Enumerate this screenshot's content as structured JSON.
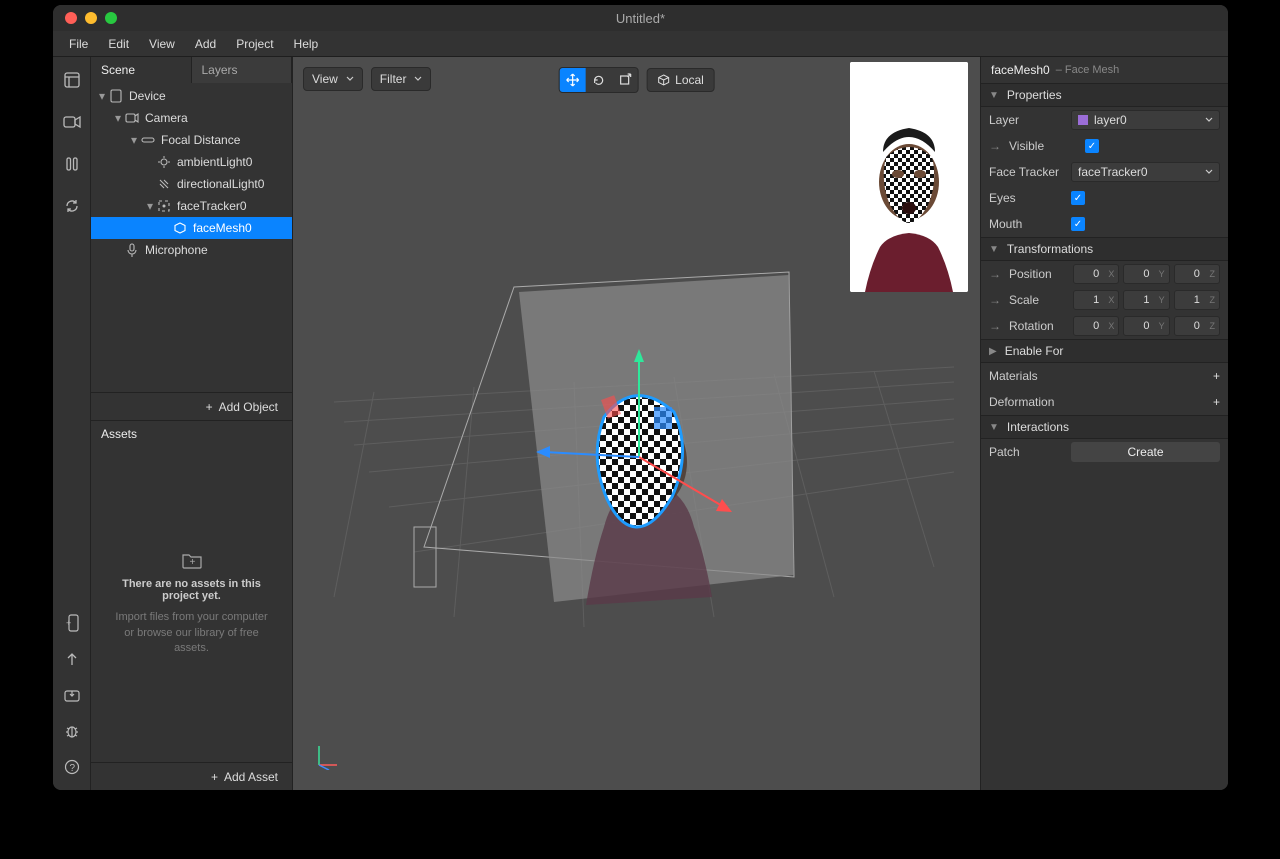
{
  "window": {
    "title": "Untitled*"
  },
  "menu": [
    "File",
    "Edit",
    "View",
    "Add",
    "Project",
    "Help"
  ],
  "scene_panel": {
    "tabs": [
      "Scene",
      "Layers"
    ],
    "add_object": "Add Object",
    "tree": [
      {
        "label": "Device",
        "indent": 0,
        "icon": "device",
        "expandable": true
      },
      {
        "label": "Camera",
        "indent": 1,
        "icon": "camera",
        "expandable": true
      },
      {
        "label": "Focal Distance",
        "indent": 2,
        "icon": "focal",
        "expandable": true
      },
      {
        "label": "ambientLight0",
        "indent": 3,
        "icon": "light",
        "expandable": false
      },
      {
        "label": "directionalLight0",
        "indent": 3,
        "icon": "dirlight",
        "expandable": false
      },
      {
        "label": "faceTracker0",
        "indent": 3,
        "icon": "tracker",
        "expandable": true
      },
      {
        "label": "faceMesh0",
        "indent": 4,
        "icon": "mesh",
        "expandable": false,
        "selected": true
      },
      {
        "label": "Microphone",
        "indent": 1,
        "icon": "mic",
        "expandable": false
      }
    ]
  },
  "assets": {
    "title": "Assets",
    "empty_title": "There are no assets in this project yet.",
    "empty_hint": "Import files from your computer or browse our library of free assets.",
    "add_asset": "Add Asset"
  },
  "viewport": {
    "view_label": "View",
    "filter_label": "Filter",
    "local_label": "Local"
  },
  "inspector": {
    "name": "faceMesh0",
    "type": "– Face Mesh",
    "sections": {
      "properties": "Properties",
      "transformations": "Transformations",
      "enable_for": "Enable For",
      "materials": "Materials",
      "deformation": "Deformation",
      "interactions": "Interactions"
    },
    "labels": {
      "layer": "Layer",
      "visible": "Visible",
      "face_tracker": "Face Tracker",
      "eyes": "Eyes",
      "mouth": "Mouth",
      "position": "Position",
      "scale": "Scale",
      "rotation": "Rotation",
      "patch": "Patch",
      "create": "Create"
    },
    "values": {
      "layer": "layer0",
      "face_tracker": "faceTracker0",
      "visible": true,
      "eyes": true,
      "mouth": true,
      "position": {
        "x": "0",
        "y": "0",
        "z": "0"
      },
      "scale": {
        "x": "1",
        "y": "1",
        "z": "1"
      },
      "rotation": {
        "x": "0",
        "y": "0",
        "z": "0"
      }
    }
  }
}
